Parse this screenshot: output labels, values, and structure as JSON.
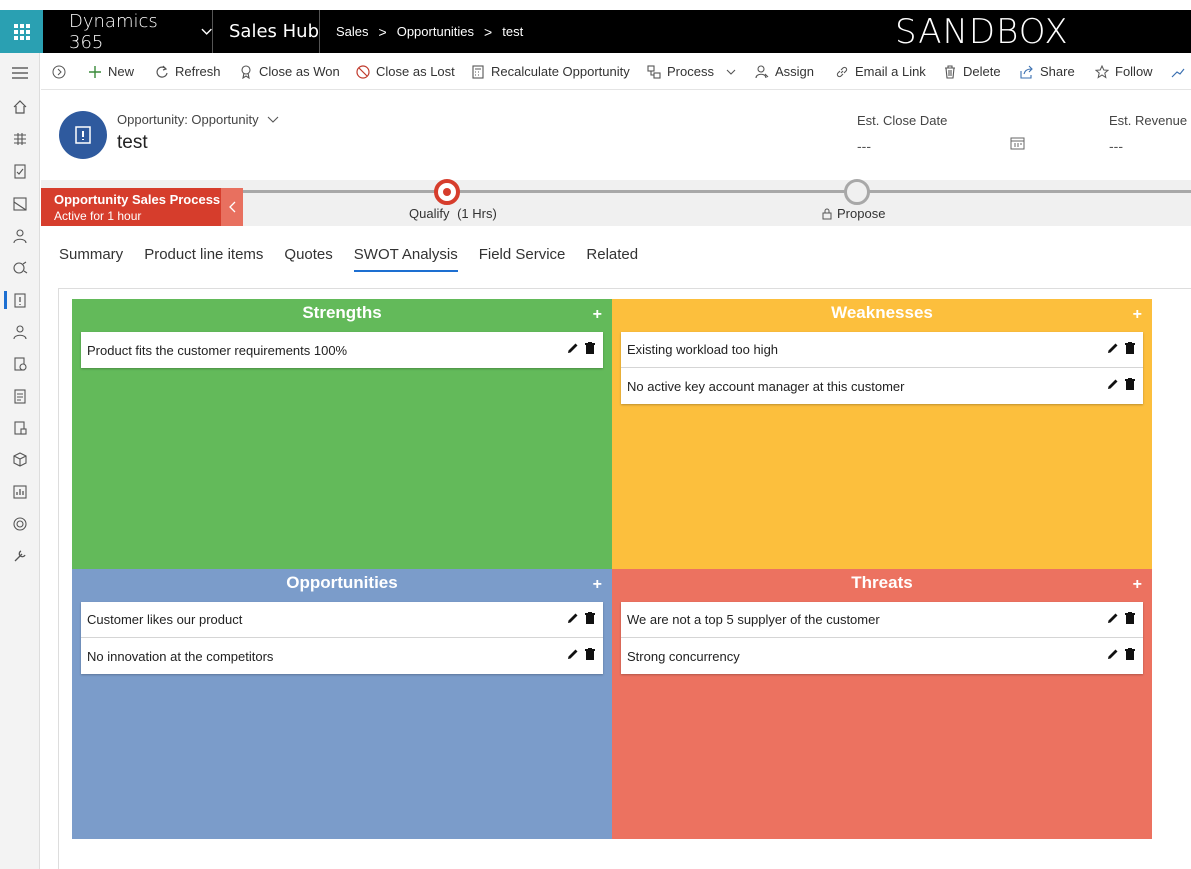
{
  "topbar": {
    "app_name": "Dynamics 365",
    "module_name": "Sales Hub",
    "breadcrumb": [
      "Sales",
      "Opportunities",
      "test"
    ],
    "environment_label": "SANDBOX"
  },
  "left_nav": {
    "icons": [
      "hamburger-menu-icon",
      "home-icon",
      "pinned-icon",
      "activities-icon",
      "dashboards-icon",
      "contacts-icon",
      "accounts-icon",
      "opportunities-icon",
      "leads-icon",
      "quotes-icon",
      "orders-icon",
      "invoices-icon",
      "products-icon",
      "reports-icon",
      "goals-icon",
      "settings-icon"
    ],
    "active": "opportunities-icon"
  },
  "command_bar": {
    "items": [
      {
        "label": "New",
        "icon": "plus-icon"
      },
      {
        "label": "Refresh",
        "icon": "refresh-icon"
      },
      {
        "label": "Close as Won",
        "icon": "award-icon"
      },
      {
        "label": "Close as Lost",
        "icon": "block-icon"
      },
      {
        "label": "Recalculate Opportunity",
        "icon": "calculator-icon"
      },
      {
        "label": "Process",
        "icon": "process-icon"
      },
      {
        "label": "Assign",
        "icon": "assign-icon"
      },
      {
        "label": "Email a Link",
        "icon": "link-icon"
      },
      {
        "label": "Delete",
        "icon": "trash-icon"
      },
      {
        "label": "Share",
        "icon": "share-icon"
      },
      {
        "label": "Follow",
        "icon": "star-icon"
      }
    ]
  },
  "header": {
    "entity_type": "Opportunity: Opportunity",
    "record_name": "test",
    "fields": [
      {
        "label": "Est. Close Date",
        "value": "---"
      },
      {
        "label": "Est. Revenue",
        "value": "---"
      }
    ]
  },
  "process": {
    "name": "Opportunity Sales Process",
    "status": "Active for 1 hour",
    "stages": [
      {
        "label": "Qualify",
        "duration": "(1 Hrs)",
        "state": "active"
      },
      {
        "label": "Propose",
        "state": "locked"
      }
    ]
  },
  "tabs": {
    "items": [
      "Summary",
      "Product line items",
      "Quotes",
      "SWOT Analysis",
      "Field Service",
      "Related"
    ],
    "active": "SWOT Analysis"
  },
  "swot": {
    "add_label": "+",
    "quadrants": [
      {
        "title": "Strengths",
        "color": "#63ba5a",
        "items": [
          "Product fits the customer requirements 100%"
        ]
      },
      {
        "title": "Weaknesses",
        "color": "#fcbf3d",
        "items": [
          "Existing workload too high",
          "No active key account manager at this customer"
        ]
      },
      {
        "title": "Opportunities",
        "color": "#7b9cca",
        "items": [
          "Customer likes our product",
          "No innovation at the competitors"
        ]
      },
      {
        "title": "Threats",
        "color": "#ec7260",
        "items": [
          "We are not a top 5 supplyer of the customer",
          "Strong concurrency"
        ]
      }
    ]
  }
}
